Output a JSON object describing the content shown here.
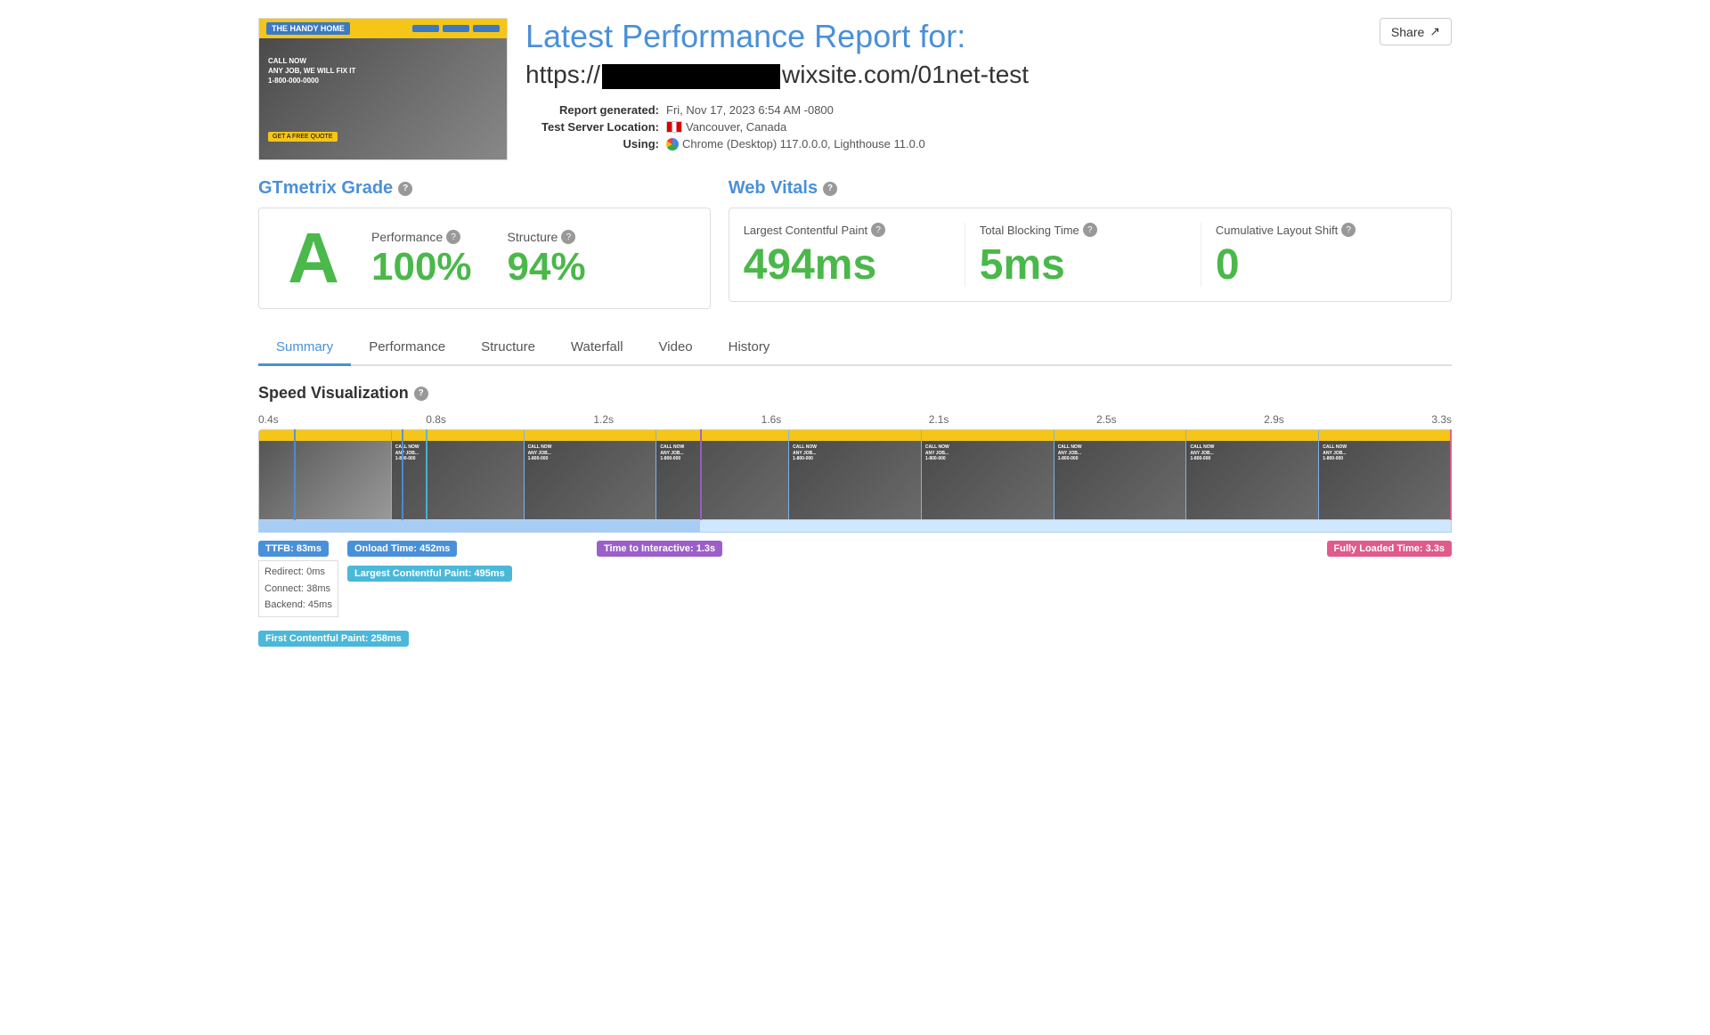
{
  "header": {
    "title": "Latest Performance Report for:",
    "url_prefix": "https://",
    "url_suffix": "wixsite.com/01net-test",
    "share_label": "Share"
  },
  "meta": {
    "report_generated_label": "Report generated:",
    "report_generated_value": "Fri, Nov 17, 2023 6:54 AM -0800",
    "server_location_label": "Test Server Location:",
    "server_location_value": "Vancouver, Canada",
    "using_label": "Using:",
    "using_value": "Chrome (Desktop) 117.0.0.0, Lighthouse 11.0.0"
  },
  "gtmetrix": {
    "section_title": "GTmetrix Grade",
    "grade": "A",
    "performance_label": "Performance",
    "performance_value": "100%",
    "structure_label": "Structure",
    "structure_value": "94%"
  },
  "web_vitals": {
    "section_title": "Web Vitals",
    "lcp_label": "Largest Contentful Paint",
    "lcp_value": "494ms",
    "tbt_label": "Total Blocking Time",
    "tbt_value": "5ms",
    "cls_label": "Cumulative Layout Shift",
    "cls_value": "0"
  },
  "tabs": [
    {
      "label": "Summary",
      "active": true
    },
    {
      "label": "Performance",
      "active": false
    },
    {
      "label": "Structure",
      "active": false
    },
    {
      "label": "Waterfall",
      "active": false
    },
    {
      "label": "Video",
      "active": false
    },
    {
      "label": "History",
      "active": false
    }
  ],
  "speed_viz": {
    "title": "Speed Visualization",
    "ruler_marks": [
      "0.4s",
      "0.8s",
      "1.2s",
      "1.6s",
      "2.1s",
      "2.5s",
      "2.9s",
      "3.3s"
    ],
    "timings": {
      "ttfb": "TTFB: 83ms",
      "ttfb_redirect": "Redirect: 0ms",
      "ttfb_connect": "Connect: 38ms",
      "ttfb_backend": "Backend: 45ms",
      "onload": "Onload Time: 452ms",
      "lcp": "Largest Contentful Paint: 495ms",
      "interactive": "Time to Interactive: 1.3s",
      "fully_loaded": "Fully Loaded Time: 3.3s",
      "fcp": "First Contentful Paint: 258ms"
    }
  }
}
